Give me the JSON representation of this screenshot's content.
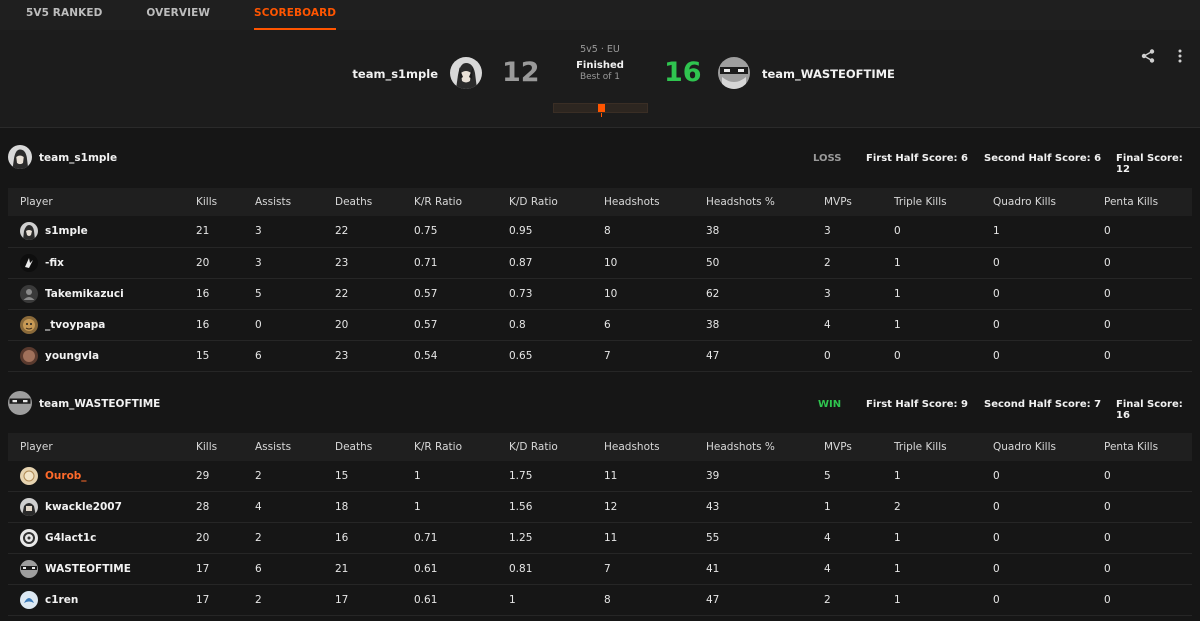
{
  "nav": {
    "tabs": [
      {
        "label": "5V5 RANKED",
        "active": false
      },
      {
        "label": "OVERVIEW",
        "active": false
      },
      {
        "label": "SCOREBOARD",
        "active": true
      }
    ]
  },
  "match": {
    "mode": "5v5 · EU",
    "status": "Finished",
    "best_of": "Best of 1",
    "progress_fraction": 0.5,
    "left_team": {
      "name": "team_s1mple",
      "score": "12"
    },
    "right_team": {
      "name": "team_WASTEOFTIME",
      "score": "16"
    },
    "colors": {
      "accent": "#ff5500",
      "win": "#2fc44f",
      "loss": "#9a9a9a"
    },
    "icons": {
      "share": "share-icon",
      "more": "more-vertical-icon"
    }
  },
  "columns": [
    "Player",
    "Kills",
    "Assists",
    "Deaths",
    "K/R Ratio",
    "K/D Ratio",
    "Headshots",
    "Headshots %",
    "MVPs",
    "Triple Kills",
    "Quadro Kills",
    "Penta Kills"
  ],
  "teams": [
    {
      "name": "team_s1mple",
      "result": "LOSS",
      "first_half": "First Half Score: 6",
      "second_half": "Second Half Score: 6",
      "final": "Final Score: 12",
      "players": [
        {
          "name": "s1mple",
          "kills": "21",
          "assists": "3",
          "deaths": "22",
          "kr": "0.75",
          "kd": "0.95",
          "hs": "8",
          "hsp": "38",
          "mvps": "3",
          "triple": "0",
          "quadro": "1",
          "penta": "0"
        },
        {
          "name": "-fix",
          "kills": "20",
          "assists": "3",
          "deaths": "23",
          "kr": "0.71",
          "kd": "0.87",
          "hs": "10",
          "hsp": "50",
          "mvps": "2",
          "triple": "1",
          "quadro": "0",
          "penta": "0"
        },
        {
          "name": "Takemikazuci",
          "kills": "16",
          "assists": "5",
          "deaths": "22",
          "kr": "0.57",
          "kd": "0.73",
          "hs": "10",
          "hsp": "62",
          "mvps": "3",
          "triple": "1",
          "quadro": "0",
          "penta": "0"
        },
        {
          "name": "_tvoypapa",
          "kills": "16",
          "assists": "0",
          "deaths": "20",
          "kr": "0.57",
          "kd": "0.8",
          "hs": "6",
          "hsp": "38",
          "mvps": "4",
          "triple": "1",
          "quadro": "0",
          "penta": "0"
        },
        {
          "name": "youngvla",
          "kills": "15",
          "assists": "6",
          "deaths": "23",
          "kr": "0.54",
          "kd": "0.65",
          "hs": "7",
          "hsp": "47",
          "mvps": "0",
          "triple": "0",
          "quadro": "0",
          "penta": "0"
        }
      ]
    },
    {
      "name": "team_WASTEOFTIME",
      "result": "WIN",
      "first_half": "First Half Score: 9",
      "second_half": "Second Half Score: 7",
      "final": "Final Score: 16",
      "players": [
        {
          "name": "Ourob_",
          "kills": "29",
          "assists": "2",
          "deaths": "15",
          "kr": "1",
          "kd": "1.75",
          "hs": "11",
          "hsp": "39",
          "mvps": "5",
          "triple": "1",
          "quadro": "0",
          "penta": "0"
        },
        {
          "name": "kwackle2007",
          "kills": "28",
          "assists": "4",
          "deaths": "18",
          "kr": "1",
          "kd": "1.56",
          "hs": "12",
          "hsp": "43",
          "mvps": "1",
          "triple": "2",
          "quadro": "0",
          "penta": "0"
        },
        {
          "name": "G4lact1c",
          "kills": "20",
          "assists": "2",
          "deaths": "16",
          "kr": "0.71",
          "kd": "1.25",
          "hs": "11",
          "hsp": "55",
          "mvps": "4",
          "triple": "1",
          "quadro": "0",
          "penta": "0"
        },
        {
          "name": "WASTEOFTIME",
          "kills": "17",
          "assists": "6",
          "deaths": "21",
          "kr": "0.61",
          "kd": "0.81",
          "hs": "7",
          "hsp": "41",
          "mvps": "4",
          "triple": "1",
          "quadro": "0",
          "penta": "0"
        },
        {
          "name": "c1ren",
          "kills": "17",
          "assists": "2",
          "deaths": "17",
          "kr": "0.61",
          "kd": "1",
          "hs": "8",
          "hsp": "47",
          "mvps": "2",
          "triple": "1",
          "quadro": "0",
          "penta": "0"
        }
      ]
    }
  ]
}
